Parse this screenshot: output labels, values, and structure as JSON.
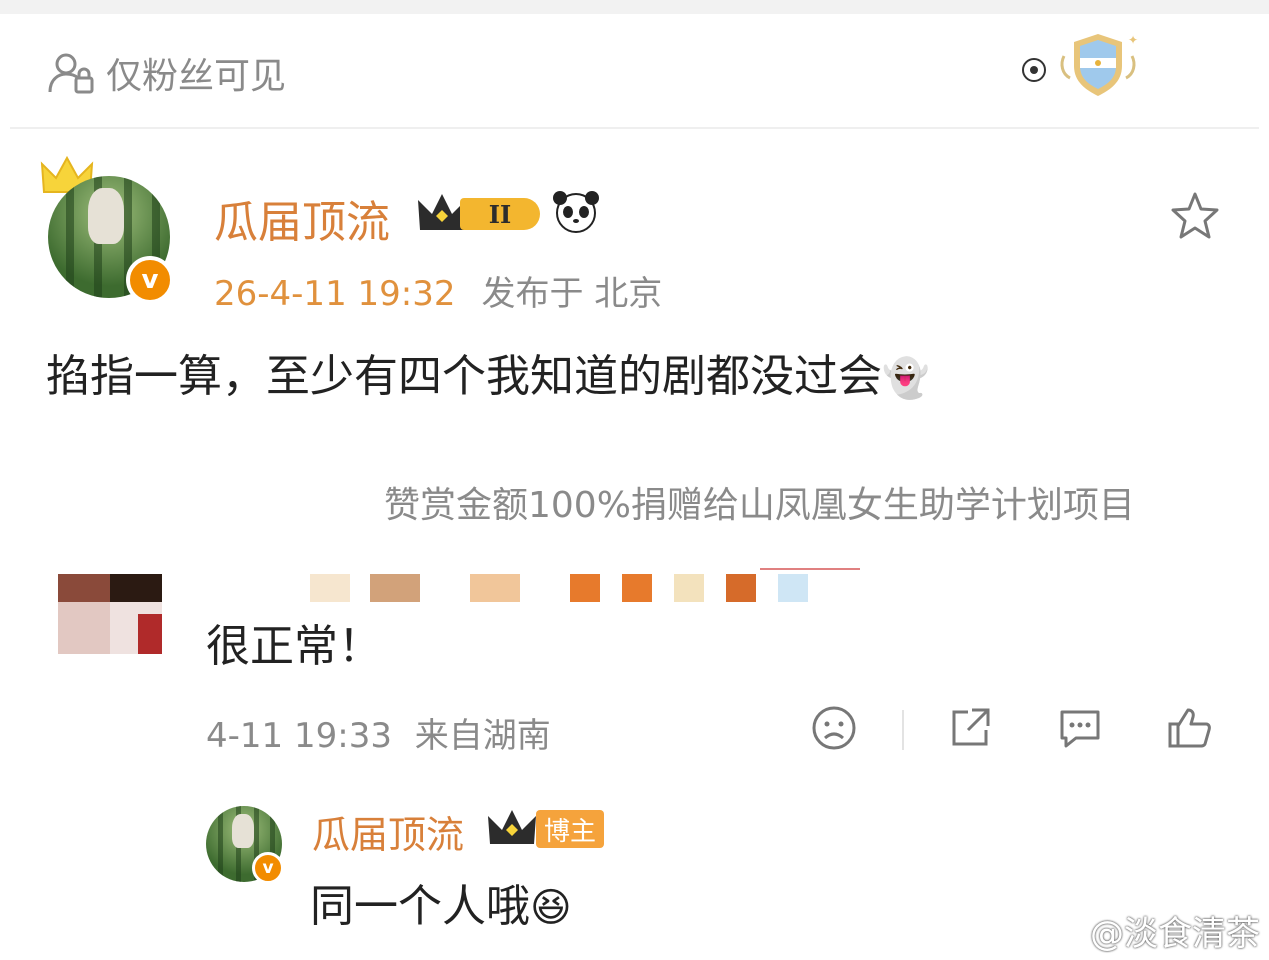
{
  "header": {
    "visibility_label": "仅粉丝可见"
  },
  "post": {
    "author_name": "瓜届顶流",
    "level_badge": "II",
    "timestamp": "26-4-11 19:32",
    "location": "发布于 北京",
    "text": "掐指一算，至少有四个我知道的剧都没过会",
    "text_emoji": "👻",
    "donation_note": "赞赏金额100%捐赠给山凤凰女生助学计划项目",
    "verify_mark": "v"
  },
  "comment": {
    "text": "很正常！",
    "timestamp": "4-11 19:33",
    "location": "来自湖南"
  },
  "reply": {
    "author_name": "瓜届顶流",
    "author_tag": "博主",
    "text": "同一个人哦",
    "text_emoji": "😆"
  },
  "watermark": "@淡食清茶",
  "colors": {
    "name_orange": "#d8803a",
    "meta_gray": "#8a8a8a",
    "verify_orange": "#f28c00"
  }
}
